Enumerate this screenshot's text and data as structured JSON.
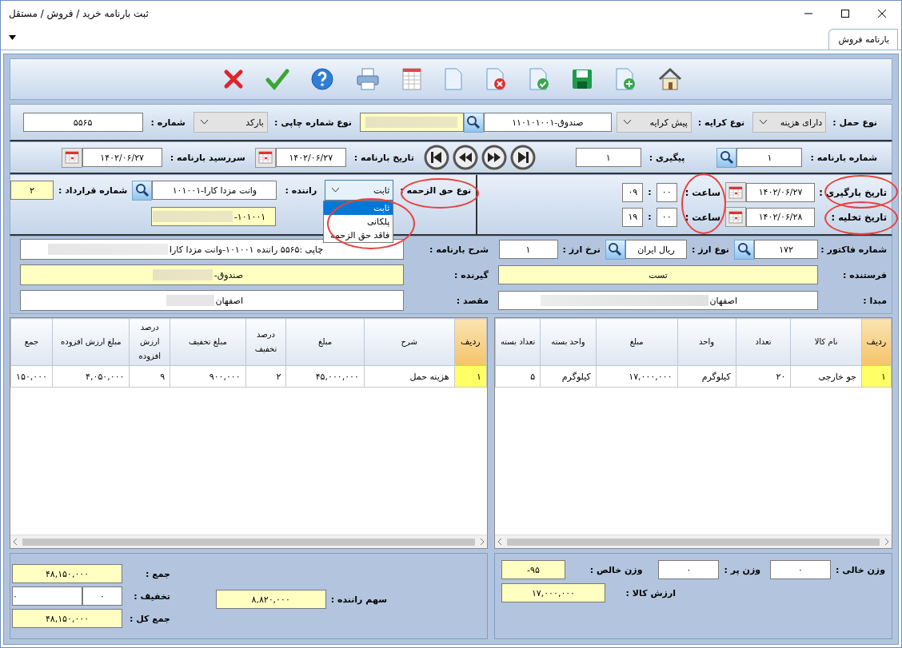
{
  "window": {
    "title": "ثبت بارنامه خرید / فروش / مستقل"
  },
  "tabs": [
    {
      "label": "بارنامه فروش",
      "selected": true
    }
  ],
  "header": {
    "carriage_type": {
      "label": "نوع حمل :",
      "value": "دارای هزینه"
    },
    "fare_type": {
      "label": "نوع کرایه :",
      "value": "پیش کرایه"
    },
    "cash_account": {
      "value": "۱۱۰۱۰۱۰۰۱-صندوق"
    },
    "print_number_type": {
      "label": "نوع شماره چاپی :",
      "value": "بارکد"
    },
    "number": {
      "label": "شماره :",
      "value": "۵۵۶۵"
    },
    "waybill_number": {
      "label": "شماره بارنامه :",
      "value": "۱"
    },
    "tracking": {
      "label": "پیگیری :",
      "value": "۱"
    },
    "waybill_date": {
      "label": "تاریخ بارنامه :",
      "value": "۱۴۰۲/۰۶/۲۷"
    },
    "due_date": {
      "label": "سررسید بارنامه :",
      "value": "۱۴۰۲/۰۶/۲۷"
    }
  },
  "schedule": [
    {
      "label": "تاریخ بارگیری :",
      "date": "۱۴۰۲/۰۶/۲۷",
      "time_label": "ساعت :",
      "minute": "۰۰",
      "separator": ":",
      "hour": "۰۹"
    },
    {
      "label": "تاریخ تخلیه :",
      "date": "۱۴۰۲/۰۶/۲۸",
      "time_label": "ساعت :",
      "minute": "۰۰",
      "separator": ":",
      "hour": "۱۹"
    }
  ],
  "driver_fee": {
    "label": "نوع حق الزحمه :",
    "value": "ثابت",
    "expanded": true,
    "options": [
      {
        "label": "ثابت",
        "selected": true
      },
      {
        "label": "پلکانی",
        "selected": false
      },
      {
        "label": "فاقد حق الزحمه",
        "selected": false
      }
    ]
  },
  "driver": {
    "label": "راننده :",
    "value": "۱۰۱۰۰۱-وانت مزدا کارا",
    "code": "۱۰۱۰۰۱-"
  },
  "contract": {
    "label": "شماره قرارداد :",
    "value": "۲"
  },
  "invoice": {
    "label": "شماره فاکتور :",
    "value": "۱۷۲"
  },
  "currency": {
    "label": "نوع ارز :",
    "value": "ریال ایران"
  },
  "rate": {
    "label": "نرخ ارز :",
    "value": "۱"
  },
  "sender": {
    "label": "فرستنده :",
    "value": "تست"
  },
  "origin": {
    "label": "مبدا :",
    "value": "اصفهان"
  },
  "description": {
    "label": "شرح بارنامه :",
    "value": "چاپی :۵۵۶۵ راننده ۱۰۱۰۰۱-وانت مزدا کارا"
  },
  "receiver": {
    "label": "گیرنده :",
    "value": "صندوق-"
  },
  "destination": {
    "label": "مقصد :",
    "value": "اصفهان"
  },
  "goods_table": {
    "columns": [
      "ردیف",
      "نام کالا",
      "تعداد",
      "واحد",
      "مبلغ",
      "واحد بسته",
      "تعداد بسته"
    ],
    "rows": [
      {
        "selected": true,
        "cells": [
          "۱",
          "جو خارجی",
          "۲۰",
          "کیلوگرم",
          "۱۷,۰۰۰,۰۰۰",
          "کیلوگرم",
          "۵"
        ]
      }
    ]
  },
  "costs_table": {
    "columns": [
      "ردیف",
      "شرح",
      "مبلغ",
      "درصد تخفیف",
      "مبلغ تخفیف",
      "درصد ارزش افزوده",
      "مبلغ ارزش افزوده",
      "جمع"
    ],
    "rows": [
      {
        "selected": true,
        "cells": [
          "۱",
          "هزینه حمل",
          "۴۵,۰۰۰,۰۰۰",
          "۲",
          "۹۰۰,۰۰۰",
          "۹",
          "۴,۰۵۰,۰۰۰",
          "۱۵۰,۰۰۰"
        ]
      }
    ]
  },
  "weights": {
    "empty": {
      "label": "وزن خالی :",
      "value": "۰"
    },
    "full": {
      "label": "وزن پر :",
      "value": "۰"
    },
    "net": {
      "label": "وزن خالص :",
      "value": "-۹۵"
    },
    "goods_value": {
      "label": "ارزش کالا :",
      "value": "۱۷,۰۰۰,۰۰۰"
    }
  },
  "totals": {
    "sum": {
      "label": "جمع :",
      "value": "۴۸,۱۵۰,۰۰۰"
    },
    "discount": {
      "label": "تخفیف :",
      "percent": "۰",
      "amount": "۰"
    },
    "grand_total": {
      "label": "جمع کل :",
      "value": "۴۸,۱۵۰,۰۰۰"
    },
    "driver_share": {
      "label": "سهم راننده :",
      "value": "۸,۸۲۰,۰۰۰"
    }
  }
}
